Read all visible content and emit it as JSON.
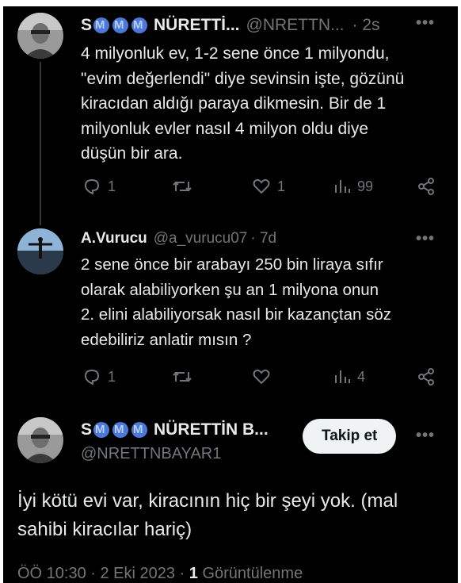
{
  "tweet1": {
    "name": "S",
    "name_suffix": "NÜRETTİ...",
    "handle": "@NRETTN...",
    "time": "· 2s",
    "text_lines": [
      "4 milyonluk ev, 1-2 sene önce 1 milyondu,",
      "\"evim değerlendi\" diye sevinsin işte, gözünü",
      "kiracıdan aldığı paraya dikmesin. Bir de 1",
      "milyonluk evler nasıl 4 milyon oldu diye",
      "düşün bir ara."
    ],
    "replies": "1",
    "retweets": "",
    "likes": "1",
    "views": "99"
  },
  "tweet2": {
    "name": "A.Vurucu",
    "handle": "@a_vurucu07",
    "time": "· 7d",
    "text_lines": [
      "2 sene önce  bir arabayı 250 bin liraya sıfır",
      "olarak alabiliyorken  şu an 1 milyona onun",
      "2. elini alabiliyorsak nasıl bir kazançtan söz",
      "edebiliriz anlatir mısın ?"
    ],
    "replies": "1",
    "retweets": "",
    "likes": "",
    "views": "4"
  },
  "main_tweet": {
    "name": "S",
    "name_suffix": "NÜRETTİN B...",
    "handle": "@NRETTNBAYAR1",
    "follow_label": "Takip et",
    "text_lines": [
      "İyi kötü evi var, kiracının hiç bir şeyi yok. (mal",
      "sahibi kiracılar hariç)"
    ],
    "meta_time": "ÖÖ 10:30 · 2 Eki 2023 · ",
    "meta_views_count": "1",
    "meta_views_label": " Görüntülenme"
  },
  "icons": [
    "more-icon",
    "reply-icon",
    "retweet-icon",
    "like-icon",
    "views-icon",
    "share-icon",
    "verified-badge-icon"
  ],
  "colors": {
    "background": "#000000",
    "text": "#e7e9ea",
    "muted": "#71767b",
    "badge": "#4a79d9"
  }
}
